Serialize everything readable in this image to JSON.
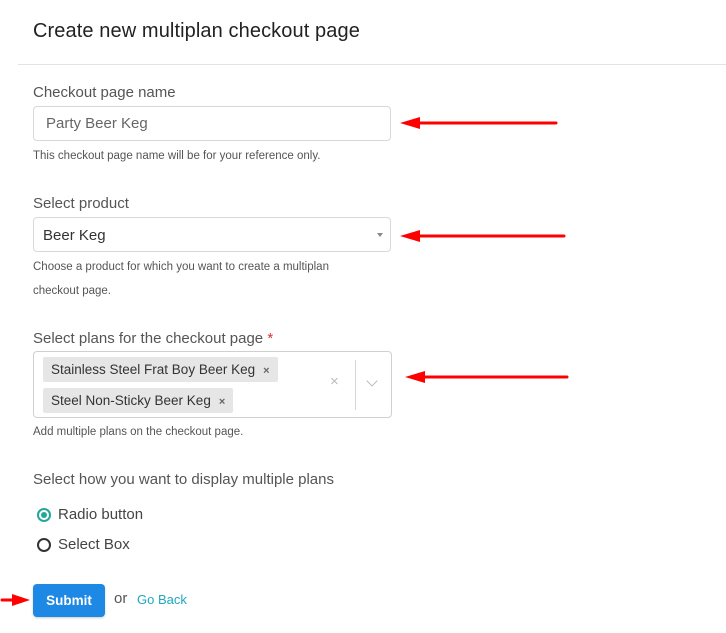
{
  "page": {
    "title": "Create new multiplan checkout page"
  },
  "form": {
    "checkout_name": {
      "label": "Checkout page name",
      "value": "Party Beer Keg",
      "help": "This checkout page name will be for your reference only."
    },
    "product": {
      "label": "Select product",
      "selected": "Beer Keg",
      "help_line1": "Choose a product for which you want to create a multiplan",
      "help_line2": "checkout page."
    },
    "plans": {
      "label": "Select plans for the checkout page",
      "required_mark": "*",
      "selected": [
        {
          "label": "Stainless Steel Frat Boy Beer Keg",
          "remove": "×"
        },
        {
          "label": "Steel Non-Sticky Beer Keg",
          "remove": "×"
        }
      ],
      "clear_icon": "×",
      "help": "Add multiple plans on the checkout page."
    },
    "display": {
      "label": "Select how you want to display multiple plans",
      "options": [
        {
          "label": "Radio button",
          "checked": true
        },
        {
          "label": "Select Box",
          "checked": false
        }
      ]
    },
    "submit_label": "Submit",
    "or_text": "or",
    "go_back_label": "Go Back"
  },
  "colors": {
    "accent_button": "#1e88e5",
    "radio_selected": "#26a69a",
    "link": "#1fa8c0",
    "annotation_arrow": "#ff0000",
    "required": "#d9302c"
  }
}
